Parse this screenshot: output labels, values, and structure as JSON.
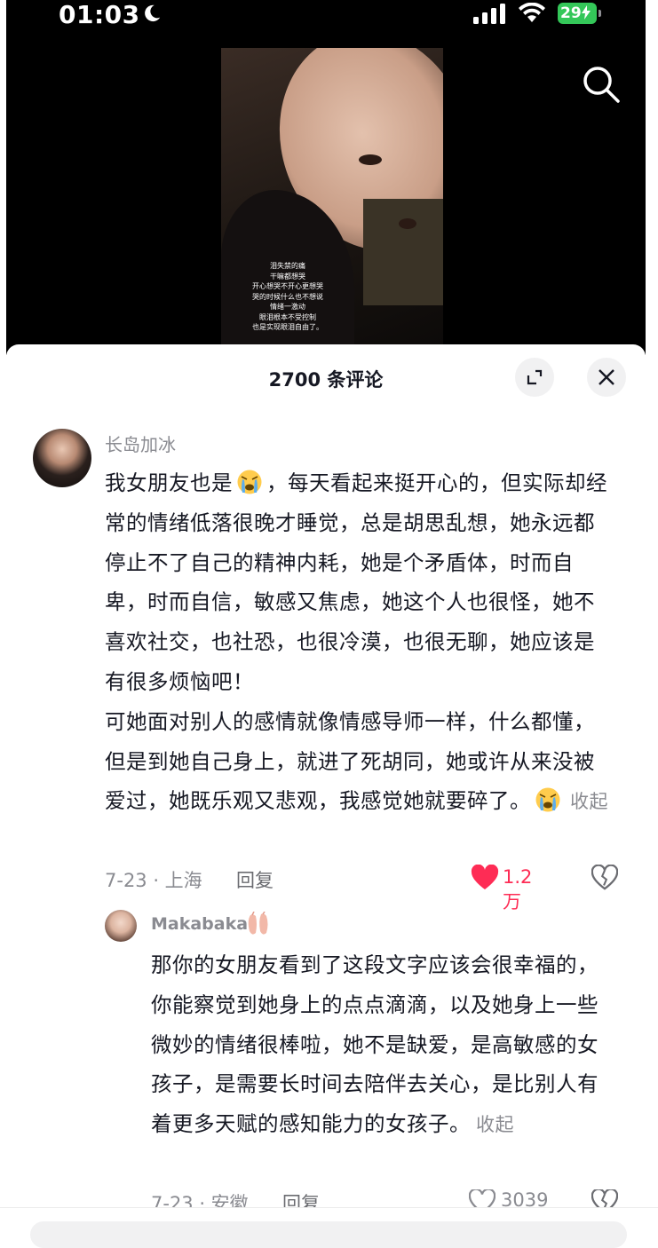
{
  "status_bar": {
    "time": "01:03",
    "battery": "29"
  },
  "video": {
    "caption_lines": [
      "泪失禁的痛",
      "干嘛都想哭",
      "开心想哭不开心更想哭",
      "哭的时候什么也不想说",
      "情绪一激动",
      "眼泪根本不受控制",
      "也是实现眼泪自由了。"
    ]
  },
  "comments_sheet": {
    "title": "2700 条评论"
  },
  "comment": {
    "username": "长岛加冰",
    "text_part1": "我女朋友也是",
    "text_part2": "，每天看起来挺开心的，但实际却经常的情绪低落很晚才睡觉，总是胡思乱想，她永远都停止不了自己的精神内耗，她是个矛盾体，时而自卑，时而自信，敏感又焦虑，她这个人也很怪，她不喜欢社交，也社恐，也很冷漠，也很无聊，她应该是有很多烦恼吧！",
    "text_part3": "可她面对别人的感情就像情感导师一样，什么都懂，但是到她自己身上，就进了死胡同，她或许从来没被爱过，她既乐观又悲观，我感觉她就要碎了。",
    "collapse_label": "收起",
    "date_location": "7-23 · 上海",
    "reply_label": "回复",
    "likes": "1.2万"
  },
  "reply": {
    "username": "Makabaka",
    "text": "那你的女朋友看到了这段文字应该会很幸福的，你能察觉到她身上的点点滴滴，以及她身上一些微妙的情绪很棒啦，她不是缺爱，是高敏感的女孩子，是需要长时间去陪伴去关心，是比别人有着更多天赋的感知能力的女孩子。",
    "collapse_label": "收起",
    "date_location": "7-23 · 安徽",
    "reply_label": "回复",
    "likes": "3039"
  },
  "colors": {
    "like_active": "#fe2c55",
    "secondary_text": "#8a8b91"
  }
}
